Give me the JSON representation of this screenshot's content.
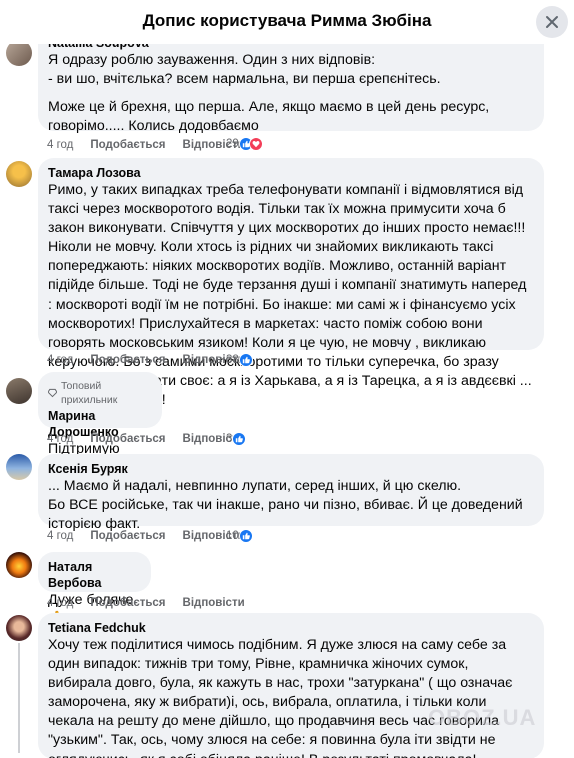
{
  "header": {
    "title": "Допис користувача Римма Зюбіна"
  },
  "actions": {
    "like": "Подобається",
    "reply": "Відповісти"
  },
  "comments": [
    {
      "author": "Nataliia Soupova",
      "text": "Я одразу роблю зауваження. Один з них відповів:\n- ви шо, вчітєлька? всем нармальна, ви перша єрепєнітесь.",
      "text2": "Може це й брехня, що перша. Але, якщо маємо в цей день ресурс, говорімо..... Колись додовбаємо",
      "time": "4 год",
      "reactions": "29",
      "reaction_icons": [
        "like-icon",
        "love-icon"
      ]
    },
    {
      "author": "Тамара Лозова",
      "text": "Римо, у таких випадках треба телефонувати компанії і відмовлятися від таксі через москворотого водія. Тільки так їх можна примусити хоча б закон виконувати. Співчуття у цих москворотих до інших просто немає!!! Ніколи не мовчу. Коли хтось із рідних чи знайомих викликають таксі попереджають: ніяких москворотих водіїв. Можливо, останній варіант підійде більше. Тоді не буде терзання душі і компанії знатимуть наперед : москвороті водії їм не потрібні. Бо інакше: ми самі ж і фінансуємо усіх москворотих! Прислухайтеся в маркетах: часто поміж собою вони говорять московським язиком! Коли я це чую, не мовчу , викликаю керуючого. Бо з самими москворотими то тільки суперечка, бо зразу починають вмикати своє: а я із Харькава, а я із Тарецка, а я із авдєєвкі ... не мовчіть ніколи!",
      "time": "4 год",
      "reactions": "38",
      "reaction_icons": [
        "like-icon"
      ]
    },
    {
      "badge": "Топовий прихильник",
      "author": "Марина Дорошенко",
      "text": "Підтримую",
      "time": "4 год",
      "reactions": "3",
      "reaction_icons": [
        "like-icon"
      ]
    },
    {
      "author": "Ксенія Буряк",
      "text": "... Маємо й надалі, невпинно лупати, серед інших, й цю скелю.\nБо ВСЕ російське, так чи інакше, рано чи пізно, вбиває. Й це доведений історією факт.",
      "time": "4 год",
      "reactions": "10",
      "reaction_icons": [
        "like-icon"
      ]
    },
    {
      "author": "Наталя Вербова",
      "text": "Дуже боляче 🙏",
      "time": "4 год",
      "reactions": "",
      "reaction_icons": []
    },
    {
      "author": "Tetiana Fedchuk",
      "text": "Хочу теж поділитися чимось подібним. Я дуже злюся на саму себе за один випадок: тижнів три тому, Рівне, крамничка жіночих сумок, вибирала довго, була, як кажуть в нас, трохи \"затуркана\" ( що означає заморочена, яку ж вибрати)і, ось, вибрала, оплатила, і тільки коли чекала на решту до мене дійшло, що продавчиня весь час говорила \"узьким\". Так, ось, чому злюся на себе: я повинна була іти звідти не оглядуючись, як я собі обіцяла раніше! В результаті промовчала! Спасувала! Не вказала на порушення закону, а повинна була!!!!!!!",
      "time": "",
      "reactions": "",
      "reaction_icons": []
    }
  ],
  "watermark": "OBOZ.UA",
  "colors": {
    "bubble": "#f0f2f5",
    "like": "#1877f2",
    "love": "#f33e58",
    "meta": "#65676b"
  }
}
